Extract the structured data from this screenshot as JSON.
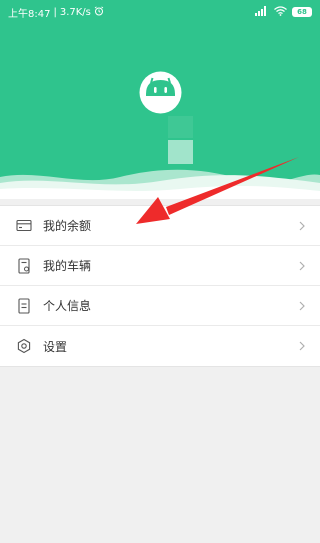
{
  "status_bar": {
    "time": "上午8:47",
    "separator": "|",
    "network_speed": "3.7K/s",
    "alarm_icon": "alarm-clock-icon",
    "battery": "68"
  },
  "header": {
    "background_color": "#2fc48d"
  },
  "menu": {
    "items": [
      {
        "label": "我的余额",
        "icon": "wallet-card-icon"
      },
      {
        "label": "我的车辆",
        "icon": "vehicle-document-icon"
      },
      {
        "label": "个人信息",
        "icon": "profile-document-icon"
      },
      {
        "label": "设置",
        "icon": "gear-icon"
      }
    ]
  },
  "annotation": {
    "color": "#ee2b2b"
  }
}
